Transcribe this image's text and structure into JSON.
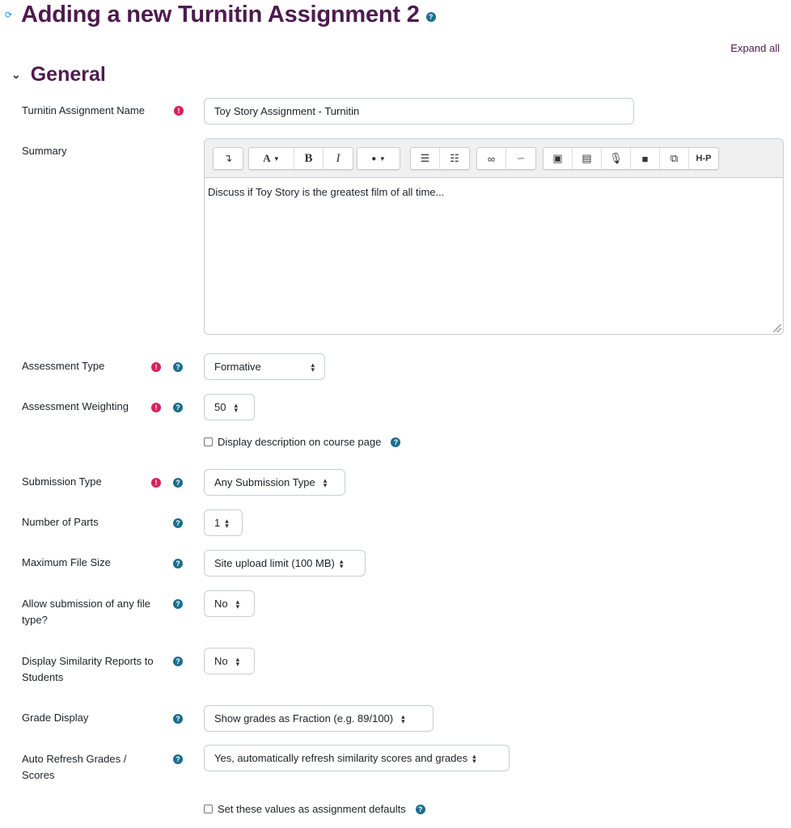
{
  "page": {
    "title": "Adding a new Turnitin Assignment 2",
    "expand_all": "Expand all",
    "section_title": "General"
  },
  "icons": {
    "required": "!",
    "help": "?",
    "select_arrows": "⬍",
    "chevron": "⌄"
  },
  "fields": {
    "name": {
      "label": "Turnitin Assignment Name",
      "value": "Toy Story Assignment - Turnitin"
    },
    "summary": {
      "label": "Summary",
      "value": "Discuss if Toy Story is the greatest film of all time...",
      "toolbar": {
        "toggle": "↴",
        "font": "A",
        "bold": "B",
        "italic": "I",
        "color": "💧",
        "unordered_list": "☰",
        "ordered_list": "☷",
        "link": "🔗",
        "unlink": "⛓",
        "image": "▣",
        "media": "▤",
        "record_audio": "🎤",
        "record_video": "■",
        "manage_files": "⧉",
        "h5p": "H-P"
      }
    },
    "assessment_type": {
      "label": "Assessment Type",
      "value": "Formative"
    },
    "assessment_weighting": {
      "label": "Assessment Weighting",
      "value": "50"
    },
    "display_description": {
      "label": "Display description on course page",
      "checked": false
    },
    "submission_type": {
      "label": "Submission Type",
      "value": "Any Submission Type"
    },
    "number_of_parts": {
      "label": "Number of Parts",
      "value": "1"
    },
    "max_file_size": {
      "label": "Maximum File Size",
      "value": "Site upload limit (100 MB)"
    },
    "allow_any_file": {
      "label_line1": "Allow submission of any file",
      "label_line2": "type?",
      "value": "No"
    },
    "display_similarity": {
      "label_line1": "Display Similarity Reports to",
      "label_line2": "Students",
      "value": "No"
    },
    "grade_display": {
      "label": "Grade Display",
      "value": "Show grades as Fraction (e.g. 89/100)"
    },
    "auto_refresh": {
      "label_line1": "Auto Refresh Grades /",
      "label_line2": "Scores",
      "value": "Yes, automatically refresh similarity scores and grades"
    },
    "set_defaults": {
      "label": "Set these values as assignment defaults",
      "checked": false
    }
  }
}
